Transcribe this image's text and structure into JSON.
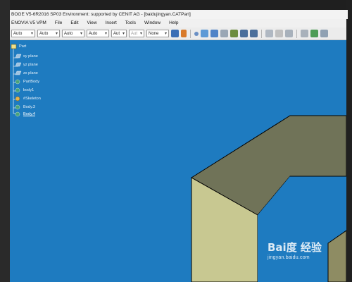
{
  "window": {
    "title": "BOGE V5-6R2016 SP03 Environment: supported by CENIT AG - [baidujingyan.CATPart]"
  },
  "menubar": {
    "items": [
      "ENOVIA V5 VPM",
      "File",
      "Edit",
      "View",
      "Insert",
      "Tools",
      "Window",
      "Help"
    ]
  },
  "toolbar": {
    "combos": [
      "Auto",
      "Auto",
      "Auto",
      "Auto",
      "Aut",
      "Aut",
      "None"
    ]
  },
  "tree": {
    "nodes": [
      {
        "label": "Part",
        "icon": "part-icon"
      },
      {
        "label": "xy plane",
        "icon": "plane-icon"
      },
      {
        "label": "yz plane",
        "icon": "plane-icon"
      },
      {
        "label": "zx plane",
        "icon": "plane-icon"
      },
      {
        "label": "PartBody",
        "icon": "body-icon"
      },
      {
        "label": "body1",
        "icon": "body-icon"
      },
      {
        "label": "#Skeleton",
        "icon": "skeleton-icon"
      },
      {
        "label": "Body.3",
        "icon": "body-icon"
      },
      {
        "label": "Body.4",
        "icon": "body-icon",
        "selected": true
      }
    ]
  },
  "watermark": {
    "brand": "Bai度 经验",
    "url": "jingyan.baidu.com"
  },
  "colors": {
    "viewport_background": "#1e7bc0",
    "model_face_top": "#707358",
    "model_face_front": "#c8c891",
    "model_face_side": "#8e8c63"
  }
}
